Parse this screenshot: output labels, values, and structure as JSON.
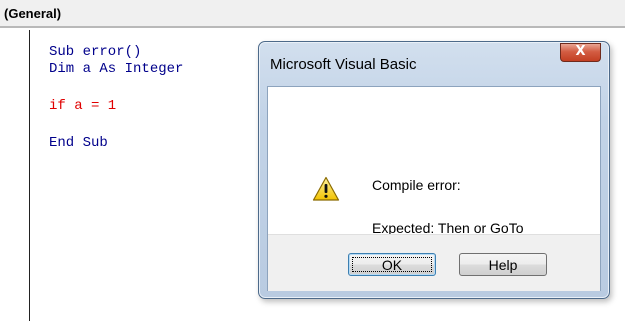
{
  "object_dropdown": {
    "label": "(General)"
  },
  "code": {
    "lines": [
      "Sub error()",
      "Dim a As Integer",
      "if a = 1",
      "End Sub"
    ]
  },
  "dialog": {
    "title": "Microsoft Visual Basic",
    "close_label": "X",
    "message_line1": "Compile error:",
    "message_line2": "Expected: Then or GoTo",
    "ok_label": "OK",
    "help_label": "Help"
  },
  "icons": {
    "warning": "warning-icon",
    "close": "close-icon"
  },
  "colors": {
    "error_line": "#e00000",
    "keyword": "#00008b",
    "close_button": "#c94a2f"
  }
}
